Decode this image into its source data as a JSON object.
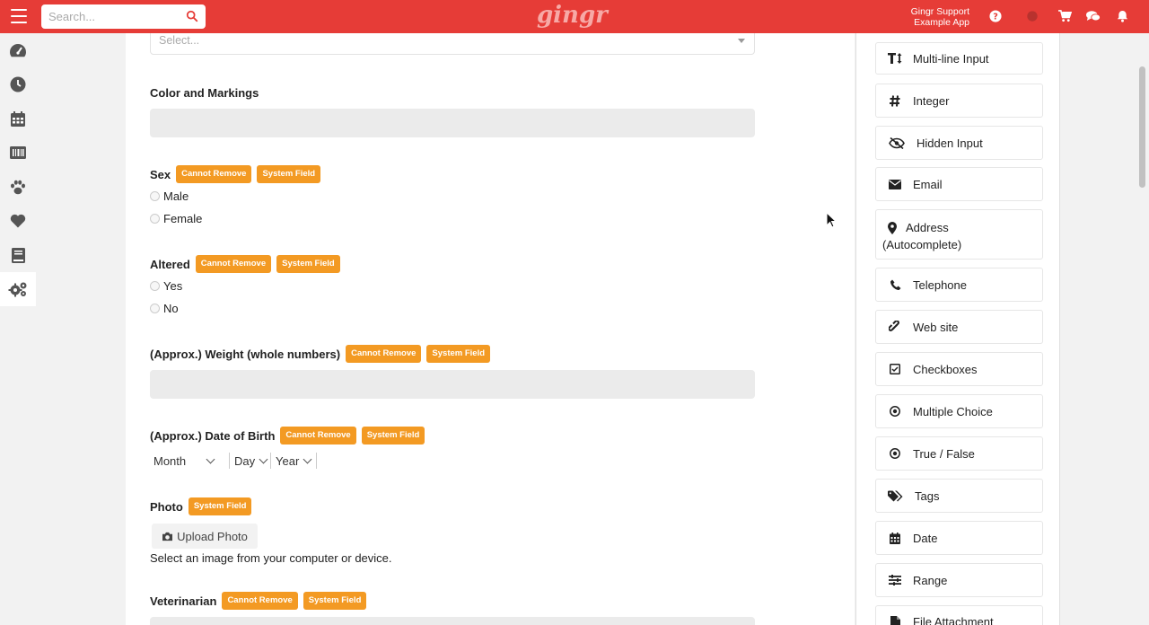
{
  "topbar": {
    "search_placeholder": "Search...",
    "logo": "gingr",
    "user_line1": "Gingr Support",
    "user_line2": "Example App",
    "accent_color": "#e63c37"
  },
  "siderail": {
    "items": [
      "dashboard-icon",
      "clock-icon",
      "calendar-icon",
      "barcode-icon",
      "paw-icon",
      "heart-icon",
      "book-icon",
      "settings-gears-icon"
    ]
  },
  "form": {
    "top_select_placeholder": "Select...",
    "color_markings_label": "Color and Markings",
    "sex": {
      "label": "Sex",
      "badges": [
        "Cannot Remove",
        "System Field"
      ],
      "options": [
        "Male",
        "Female"
      ]
    },
    "altered": {
      "label": "Altered",
      "badges": [
        "Cannot Remove",
        "System Field"
      ],
      "options": [
        "Yes",
        "No"
      ]
    },
    "weight": {
      "label": "(Approx.) Weight (whole numbers)",
      "badges": [
        "Cannot Remove",
        "System Field"
      ]
    },
    "dob": {
      "label": "(Approx.) Date of Birth",
      "badges": [
        "Cannot Remove",
        "System Field"
      ],
      "month": "Month",
      "day": "Day",
      "year": "Year"
    },
    "photo": {
      "label": "Photo",
      "badge": "System Field",
      "upload_button": "Upload Photo",
      "help": "Select an image from your computer or device."
    },
    "vet": {
      "label": "Veterinarian",
      "badges": [
        "Cannot Remove",
        "System Field"
      ]
    },
    "badge_color": "#f39a23"
  },
  "tools": [
    {
      "icon": "text-height-icon",
      "label": "Multi-line Input"
    },
    {
      "icon": "hash-icon",
      "label": "Integer"
    },
    {
      "icon": "eye-slash-icon",
      "label": "Hidden Input"
    },
    {
      "icon": "envelope-icon",
      "label": "Email"
    },
    {
      "icon": "map-marker-icon",
      "label": "Address",
      "label2": "(Autocomplete)"
    },
    {
      "icon": "phone-icon",
      "label": "Telephone"
    },
    {
      "icon": "link-icon",
      "label": "Web site"
    },
    {
      "icon": "check-square-icon",
      "label": "Checkboxes"
    },
    {
      "icon": "dot-circle-icon",
      "label": "Multiple Choice"
    },
    {
      "icon": "dot-circle-icon",
      "label": "True / False"
    },
    {
      "icon": "tags-icon",
      "label": "Tags"
    },
    {
      "icon": "calendar-icon",
      "label": "Date"
    },
    {
      "icon": "sliders-icon",
      "label": "Range"
    },
    {
      "icon": "file-icon",
      "label": "File Attachment"
    }
  ]
}
